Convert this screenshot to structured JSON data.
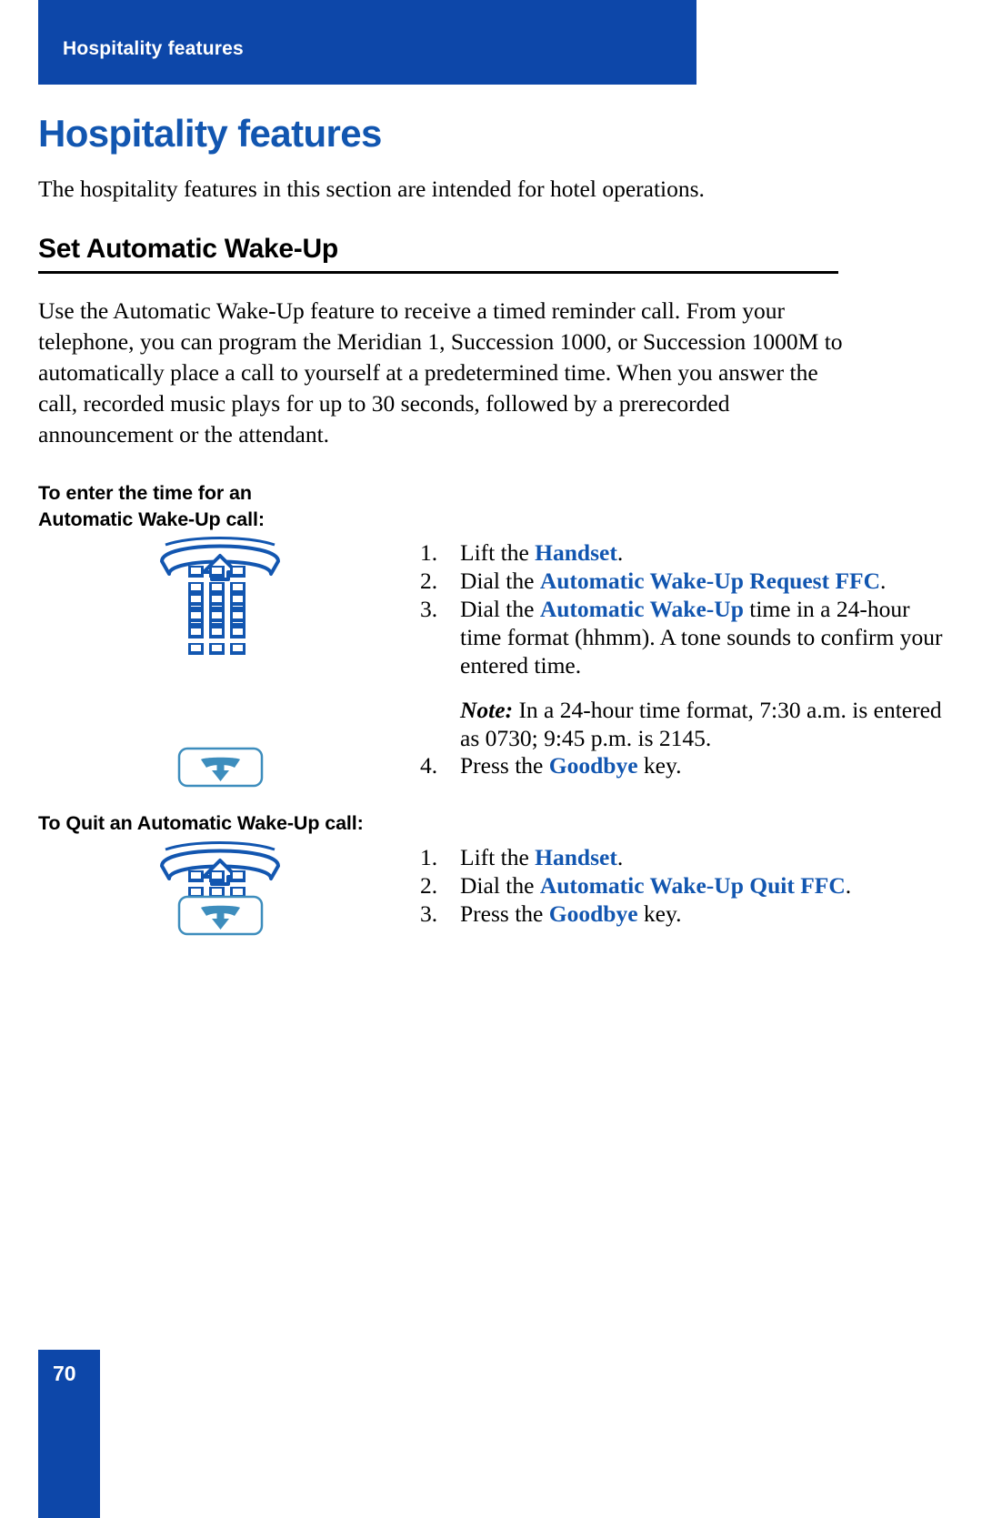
{
  "header": {
    "running_title": "Hospitality features"
  },
  "chapter": {
    "title": "Hospitality features",
    "intro": "The hospitality features in this section are intended for hotel operations."
  },
  "section": {
    "title": "Set Automatic Wake-Up",
    "body": "Use the Automatic Wake-Up feature to receive a timed reminder call. From your telephone, you can program the Meridian 1, Succession 1000, or Succession 1000M to automatically place a call to yourself at a predetermined time. When you answer the call, recorded music plays for up to 30 seconds, followed by a prerecorded announcement or the attendant."
  },
  "procedures": [
    {
      "title_line1": "To enter the time for an",
      "title_line2": "Automatic Wake-Up call:",
      "steps": [
        {
          "number": "1.",
          "icon": "lift-handset-icon",
          "parts": [
            {
              "text": "Lift the ",
              "bold": false
            },
            {
              "text": "Handset",
              "bold": true
            },
            {
              "text": ".",
              "bold": false
            }
          ]
        },
        {
          "number": "2.",
          "icon": "keypad-icon",
          "parts": [
            {
              "text": "Dial the ",
              "bold": false
            },
            {
              "text": "Automatic Wake-Up Request FFC",
              "bold": true
            },
            {
              "text": ".",
              "bold": false
            }
          ]
        },
        {
          "number": "3.",
          "icon": "keypad-icon",
          "parts": [
            {
              "text": "Dial the ",
              "bold": false
            },
            {
              "text": "Automatic Wake-Up",
              "bold": true
            },
            {
              "text": " time in a 24-hour time format (hhmm). A tone sounds to confirm your entered time.",
              "bold": false
            }
          ],
          "note_label": "Note:",
          "note_text": " In a 24-hour time format, 7:30 a.m. is entered as 0730; 9:45 p.m. is 2145."
        },
        {
          "number": "4.",
          "icon": "goodbye-key-icon",
          "parts": [
            {
              "text": "Press the ",
              "bold": false
            },
            {
              "text": "Goodbye",
              "bold": true
            },
            {
              "text": " key.",
              "bold": false
            }
          ]
        }
      ]
    },
    {
      "title_line1": "To Quit an Automatic Wake-Up call:",
      "title_line2": "",
      "steps": [
        {
          "number": "1.",
          "icon": "lift-handset-icon",
          "parts": [
            {
              "text": "Lift the ",
              "bold": false
            },
            {
              "text": "Handset",
              "bold": true
            },
            {
              "text": ".",
              "bold": false
            }
          ]
        },
        {
          "number": "2.",
          "icon": "keypad-icon",
          "parts": [
            {
              "text": "Dial the ",
              "bold": false
            },
            {
              "text": "Automatic Wake-Up Quit FFC",
              "bold": true
            },
            {
              "text": ".",
              "bold": false
            }
          ]
        },
        {
          "number": "3.",
          "icon": "goodbye-key-icon",
          "parts": [
            {
              "text": "Press the ",
              "bold": false
            },
            {
              "text": "Goodbye",
              "bold": true
            },
            {
              "text": " key.",
              "bold": false
            }
          ]
        }
      ]
    }
  ],
  "footer": {
    "page_number": "70"
  },
  "colors": {
    "brand_blue": "#0d47a9",
    "title_blue": "#1256b0",
    "icon_blue": "#1256b0",
    "goodbye_blue": "#3d8dbd"
  }
}
